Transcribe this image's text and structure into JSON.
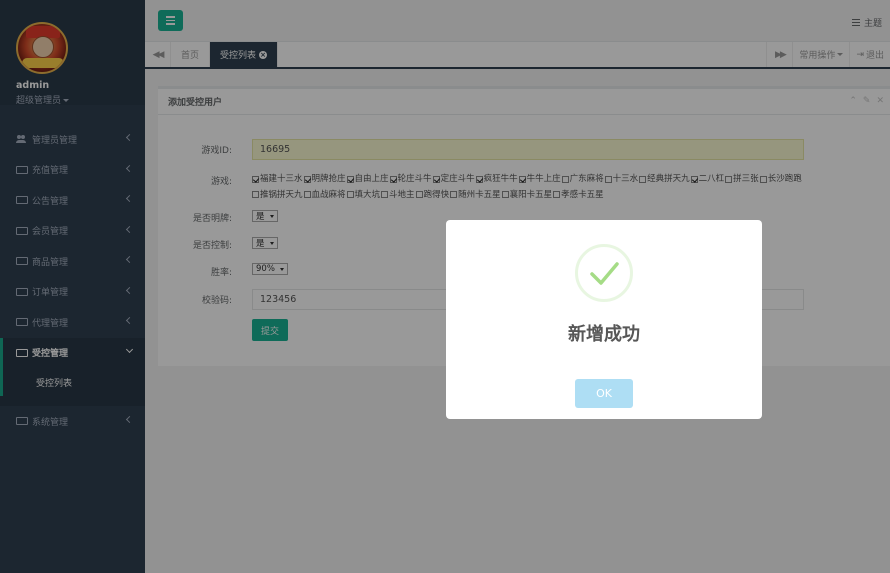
{
  "topbar": {
    "theme_label": "主题"
  },
  "user": {
    "name": "admin",
    "role": "超级管理员"
  },
  "sidebar": {
    "items": [
      {
        "label": "管理员管理"
      },
      {
        "label": "充值管理"
      },
      {
        "label": "公告管理"
      },
      {
        "label": "会员管理"
      },
      {
        "label": "商品管理"
      },
      {
        "label": "订单管理"
      },
      {
        "label": "代理管理"
      },
      {
        "label": "受控管理"
      },
      {
        "label": "系统管理"
      }
    ],
    "active_sub": "受控列表"
  },
  "tabs": {
    "home": "首页",
    "active": "受控列表",
    "common_ops": "常用操作",
    "logout": "退出"
  },
  "panel": {
    "title": "添加受控用户"
  },
  "form": {
    "game_id_label": "游戏ID:",
    "game_id_value": "16695",
    "game_label": "游戏:",
    "games": [
      {
        "name": "福建十三水",
        "checked": true
      },
      {
        "name": "明牌抢庄",
        "checked": true
      },
      {
        "name": "自由上庄",
        "checked": true
      },
      {
        "name": "轮庄斗牛",
        "checked": true
      },
      {
        "name": "定庄斗牛",
        "checked": true
      },
      {
        "name": "疯狂牛牛",
        "checked": true
      },
      {
        "name": "牛牛上庄",
        "checked": true
      },
      {
        "name": "广东麻将",
        "checked": false
      },
      {
        "name": "十三水",
        "checked": false
      },
      {
        "name": "经典拼天九",
        "checked": false
      },
      {
        "name": "二八杠",
        "checked": true
      },
      {
        "name": "拼三张",
        "checked": false
      },
      {
        "name": "长沙跑跑",
        "checked": false
      },
      {
        "name": "推锅拼天九",
        "checked": false
      },
      {
        "name": "血战麻将",
        "checked": false
      },
      {
        "name": "填大坑",
        "checked": false
      },
      {
        "name": "斗地主",
        "checked": false
      },
      {
        "name": "跑得快",
        "checked": false
      },
      {
        "name": "随州卡五星",
        "checked": false
      },
      {
        "name": "襄阳卡五星",
        "checked": false
      },
      {
        "name": "孝感卡五星",
        "checked": false
      }
    ],
    "mingpai_label": "是否明牌:",
    "mingpai_value": "是",
    "control_label": "是否控制:",
    "control_value": "是",
    "winrate_label": "胜率:",
    "winrate_value": "90%",
    "code_label": "校验码:",
    "code_value": "123456",
    "submit_label": "提交"
  },
  "modal": {
    "title": "新增成功",
    "ok_label": "OK",
    "accent": "#a5dc86"
  }
}
